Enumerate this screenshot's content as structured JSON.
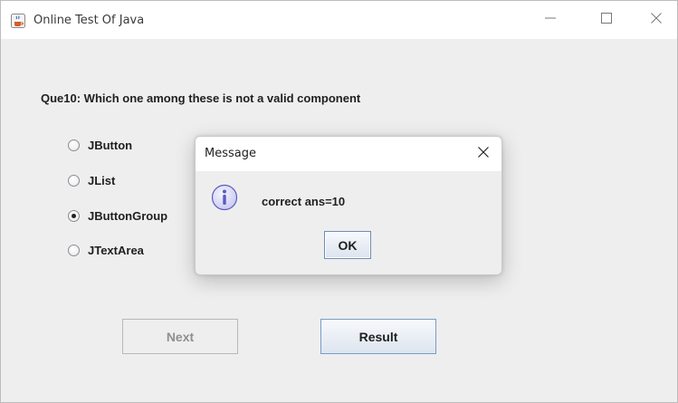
{
  "window": {
    "title": "Online Test Of Java",
    "icon": "java-cup-icon",
    "controls": [
      "minimize-icon",
      "maximize-icon",
      "close-icon"
    ]
  },
  "question": {
    "text": "Que10: Which one among these is not a valid component",
    "options": [
      {
        "label": "JButton",
        "selected": false
      },
      {
        "label": "JList",
        "selected": false
      },
      {
        "label": "JButtonGroup",
        "selected": true
      },
      {
        "label": "JTextArea",
        "selected": false
      }
    ]
  },
  "buttons": {
    "next_label": "Next",
    "next_enabled": false,
    "result_label": "Result"
  },
  "dialog": {
    "title": "Message",
    "icon": "info-icon",
    "message": "correct ans=10",
    "ok_label": "OK"
  },
  "colors": {
    "window_bg": "#eeeeee",
    "titlebar_bg": "#ffffff",
    "button_border_focus": "#7a9cc6",
    "info_icon_fill": "#dcdcf8",
    "info_icon_stroke": "#5c5cc0"
  }
}
